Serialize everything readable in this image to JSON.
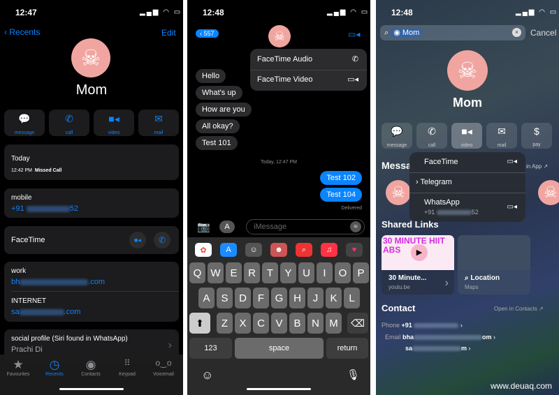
{
  "phone_call": {
    "time": "12:47",
    "back": "Recents",
    "edit": "Edit",
    "name": "Mom",
    "actions": [
      {
        "label": "message",
        "icon": "message-icon"
      },
      {
        "label": "call",
        "icon": "phone-icon"
      },
      {
        "label": "video",
        "icon": "video-icon"
      },
      {
        "label": "mail",
        "icon": "mail-icon"
      }
    ],
    "recent": {
      "day": "Today",
      "time": "12:42 PM",
      "type": "Missed Call"
    },
    "mobile": {
      "label": "mobile",
      "prefix": "+91",
      "suffix": "52"
    },
    "facetime": "FaceTime",
    "work": {
      "label": "work",
      "prefix": "bh",
      "suffix": ".com"
    },
    "internet": {
      "label": "INTERNET",
      "prefix": "sa",
      "suffix": ".com"
    },
    "social": {
      "label": "social profile (Siri found in WhatsApp)",
      "value": "Prachi Di"
    },
    "tabs": [
      {
        "label": "Favourites",
        "icon": "star-icon"
      },
      {
        "label": "Recents",
        "icon": "clock-icon",
        "active": true
      },
      {
        "label": "Contacts",
        "icon": "person-icon"
      },
      {
        "label": "Keypad",
        "icon": "keypad-icon"
      },
      {
        "label": "Voicemail",
        "icon": "voicemail-icon"
      }
    ]
  },
  "messages": {
    "time": "12:48",
    "back_count": "557",
    "menu": [
      {
        "label": "FaceTime Audio",
        "icon": "phone-icon"
      },
      {
        "label": "FaceTime Video",
        "icon": "video-icon"
      }
    ],
    "incoming": [
      "Hello",
      "What's up",
      "How are you",
      "All okay?",
      "Test 101"
    ],
    "timestamp": "Today, 12:47 PM",
    "outgoing": [
      "Test 102",
      "Test 104"
    ],
    "delivered": "Delivered",
    "placeholder": "iMessage",
    "keys_row1": [
      "Q",
      "W",
      "E",
      "R",
      "T",
      "Y",
      "U",
      "I",
      "O",
      "P"
    ],
    "keys_row2": [
      "A",
      "S",
      "D",
      "F",
      "G",
      "H",
      "J",
      "K",
      "L"
    ],
    "keys_row3": [
      "Z",
      "X",
      "C",
      "V",
      "B",
      "N",
      "M"
    ],
    "key_123": "123",
    "key_space": "space",
    "key_return": "return"
  },
  "search": {
    "time": "12:48",
    "query": "Mom",
    "cancel": "Cancel",
    "name": "Mom",
    "actions": [
      {
        "label": "message"
      },
      {
        "label": "call"
      },
      {
        "label": "video"
      },
      {
        "label": "mail"
      },
      {
        "label": "pay"
      }
    ],
    "dropdown": [
      {
        "label": "FaceTime"
      },
      {
        "label": "Telegram"
      },
      {
        "label": "WhatsApp",
        "sub_prefix": "+91",
        "sub_suffix": "52"
      }
    ],
    "messages_heading": "Messa",
    "open_in_app": "in App",
    "shared_links": "Shared Links",
    "link1": {
      "thumb_text": "30 MINUTE HIIT ABS",
      "title": "30 Minute...",
      "source": "youtu.be"
    },
    "link2": {
      "title": "Location",
      "source": "Maps"
    },
    "contact_heading": "Contact",
    "open_in_contacts": "Open in Contacts",
    "phone_label": "Phone",
    "phone_prefix": "+91",
    "email_label": "Email",
    "email1_prefix": "bha",
    "email1_suffix": "om",
    "email2_prefix": "sa",
    "email2_suffix": "m"
  },
  "watermark": "www.deuaq.com"
}
